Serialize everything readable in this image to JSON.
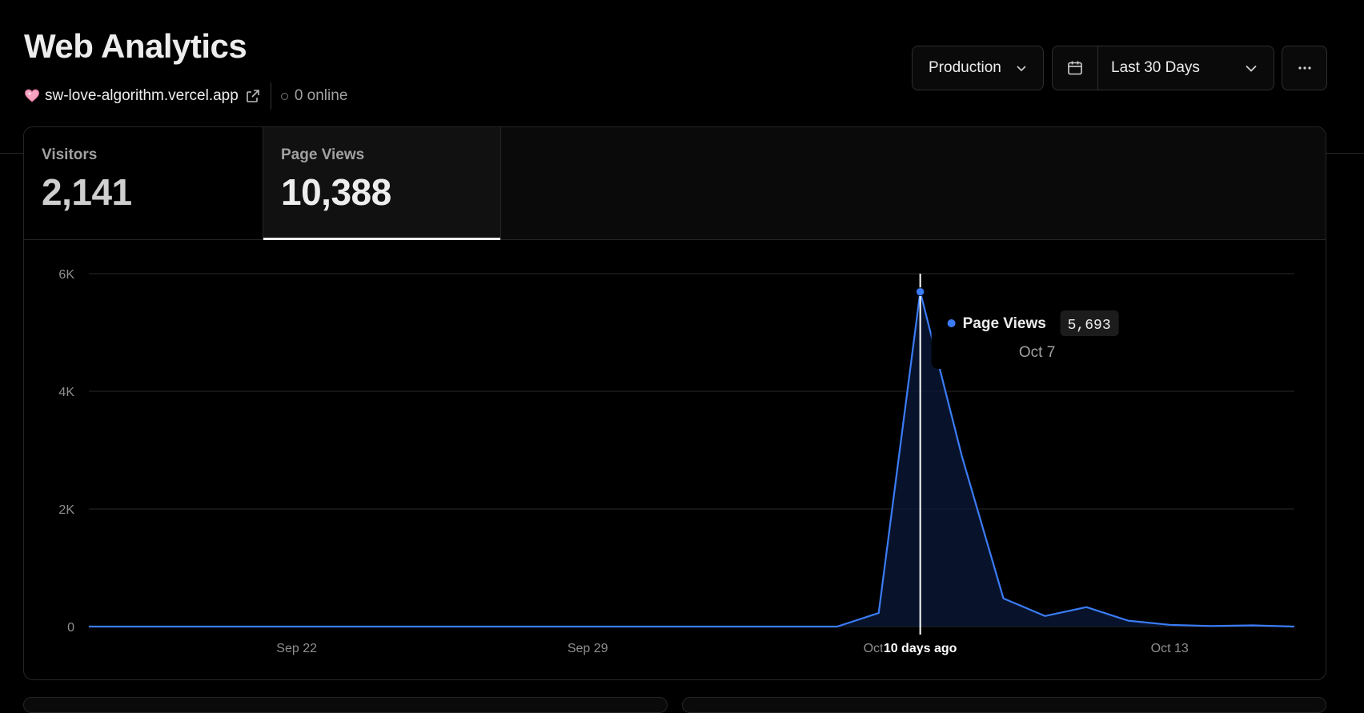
{
  "header": {
    "title": "Web Analytics",
    "site": "sw-love-algorithm.vercel.app",
    "online": "0 online"
  },
  "controls": {
    "environment": "Production",
    "range": "Last 30 Days"
  },
  "stats": [
    {
      "label": "Visitors",
      "value": "2,141"
    },
    {
      "label": "Page Views",
      "value": "10,388"
    }
  ],
  "tooltip": {
    "series": "Page Views",
    "value": "5,693",
    "date": "Oct 7",
    "cursor_label": "10 days ago"
  },
  "colors": {
    "accent": "#3b7cf6",
    "background": "#000000",
    "text": "#ededed"
  },
  "chart_data": {
    "type": "area",
    "title": "",
    "xlabel": "",
    "ylabel": "",
    "ylim": [
      0,
      6000
    ],
    "y_ticks": [
      "0",
      "2K",
      "4K",
      "6K"
    ],
    "x_tick_labels": [
      "Sep 22",
      "Sep 29",
      "Oct 6",
      "Oct 13"
    ],
    "x": [
      "Sep 17",
      "Sep 18",
      "Sep 19",
      "Sep 20",
      "Sep 21",
      "Sep 22",
      "Sep 23",
      "Sep 24",
      "Sep 25",
      "Sep 26",
      "Sep 27",
      "Sep 28",
      "Sep 29",
      "Sep 30",
      "Oct 1",
      "Oct 2",
      "Oct 3",
      "Oct 4",
      "Oct 5",
      "Oct 6",
      "Oct 7",
      "Oct 8",
      "Oct 9",
      "Oct 10",
      "Oct 11",
      "Oct 12",
      "Oct 13",
      "Oct 14",
      "Oct 15",
      "Oct 16"
    ],
    "series": [
      {
        "name": "Page Views",
        "values": [
          0,
          0,
          0,
          0,
          0,
          0,
          0,
          0,
          0,
          0,
          0,
          0,
          0,
          0,
          0,
          0,
          0,
          0,
          0,
          230,
          5693,
          2900,
          480,
          180,
          330,
          100,
          30,
          10,
          20,
          0
        ]
      }
    ],
    "highlight_index": 20,
    "grid": true
  }
}
